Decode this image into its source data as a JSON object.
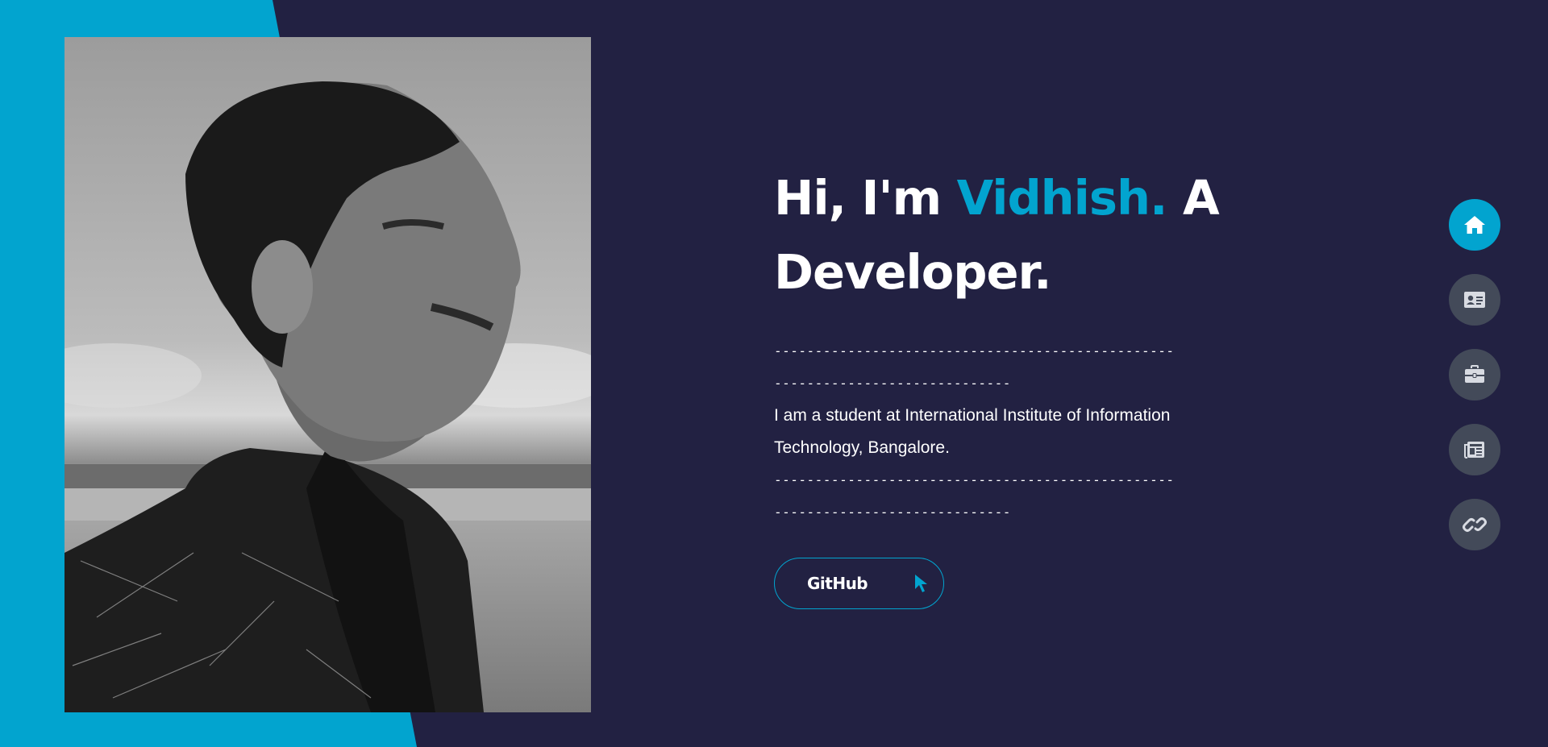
{
  "hero": {
    "greeting": "Hi, I'm ",
    "name": "Vidhish.",
    "role_a": " A",
    "role_b": "Developer.",
    "divider_top_1": "-------------------------------------------------",
    "divider_top_2": "-----------------------------",
    "bio": "I am a student at International Institute of Information Technology, Bangalore.",
    "divider_bottom_1": "-------------------------------------------------",
    "divider_bottom_2": "-----------------------------"
  },
  "cta": {
    "github_label": "GitHub"
  },
  "nav": {
    "items": [
      {
        "icon": "home-icon",
        "active": true
      },
      {
        "icon": "id-card-icon",
        "active": false
      },
      {
        "icon": "briefcase-icon",
        "active": false
      },
      {
        "icon": "newspaper-icon",
        "active": false
      },
      {
        "icon": "link-icon",
        "active": false
      }
    ]
  },
  "colors": {
    "background": "#222142",
    "accent": "#02a4cf",
    "nav_inactive": "#434a59",
    "text": "#ffffff"
  },
  "portrait": {
    "icon": "profile-photo",
    "style": "black-and-white"
  }
}
